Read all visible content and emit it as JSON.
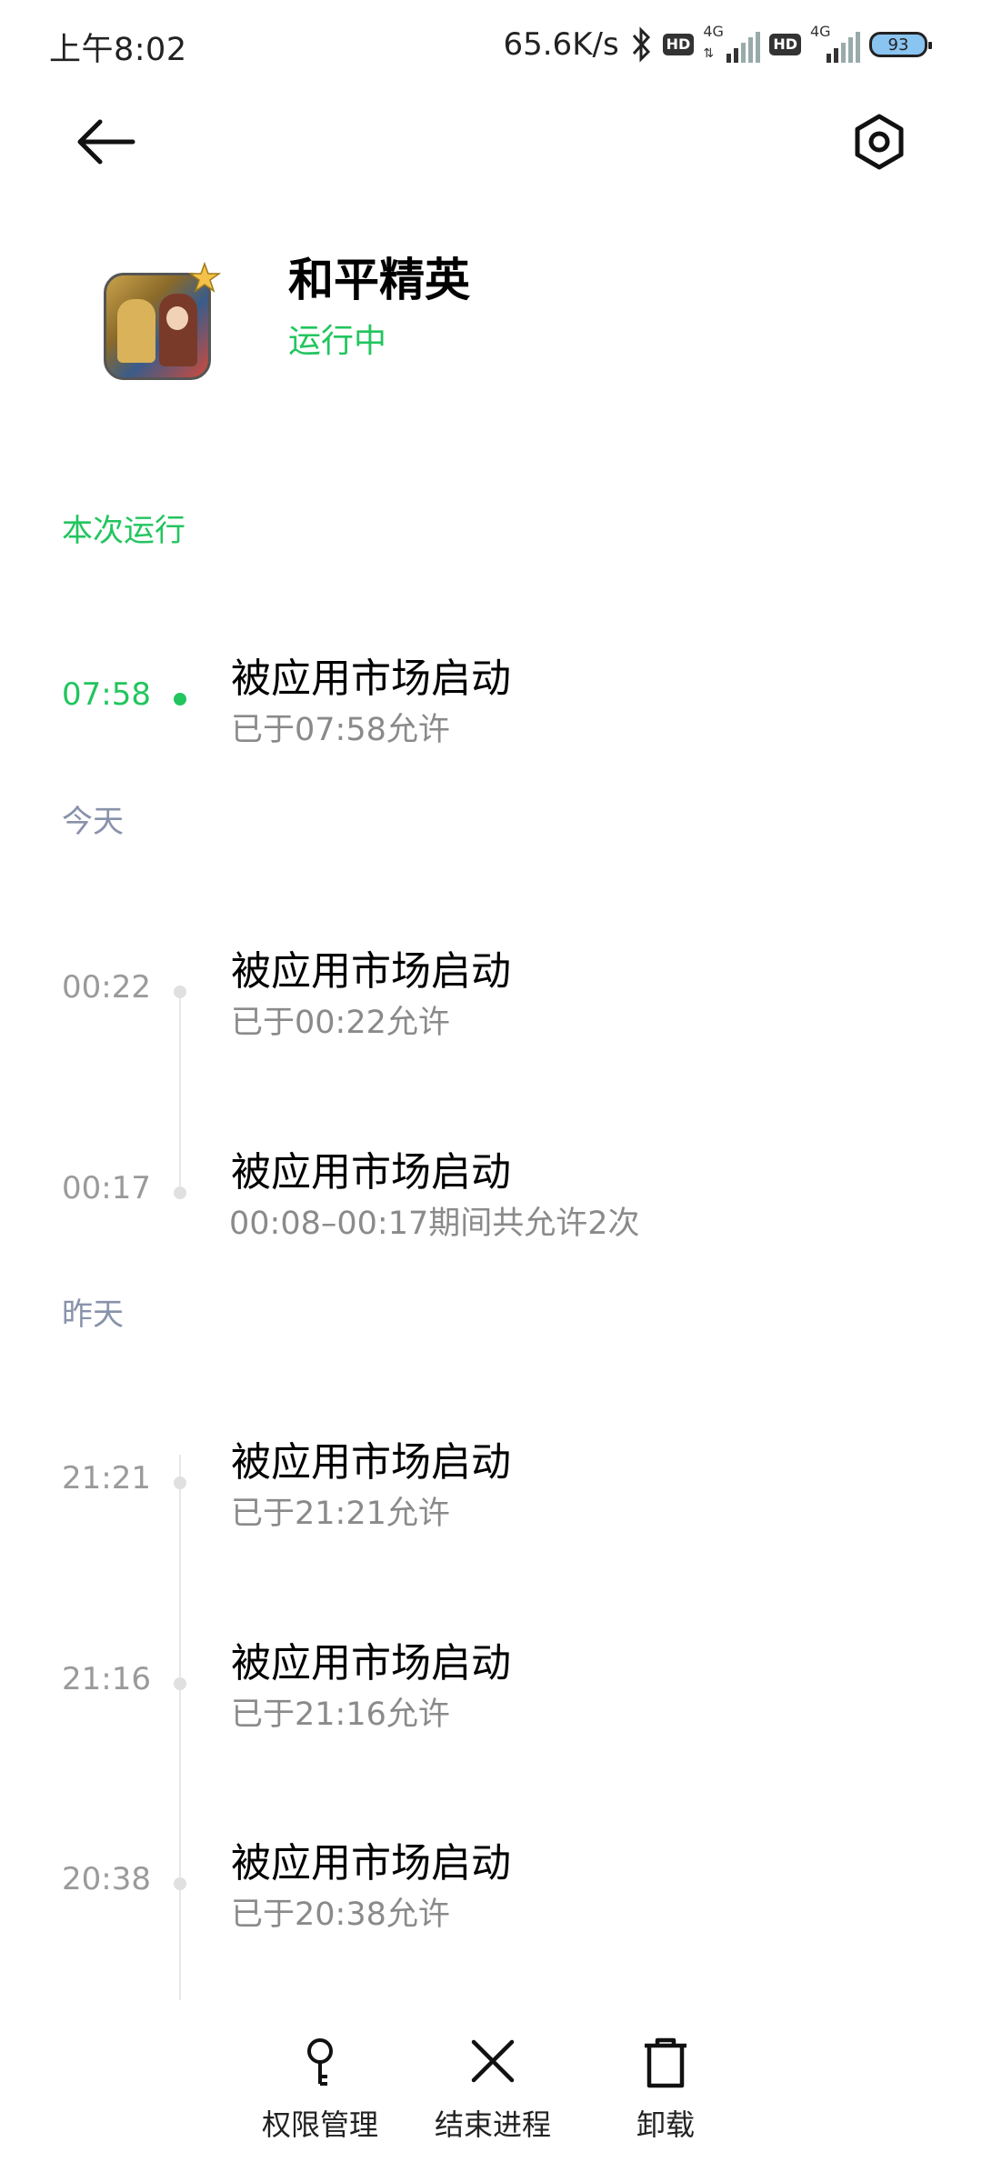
{
  "status_bar": {
    "time": "上午8:02",
    "net_speed": "65.6K/s",
    "hd1": "HD",
    "sig1_label": "4G",
    "hd2": "HD",
    "sig2_label": "4G",
    "battery": "93"
  },
  "header": {
    "back_icon": "back-arrow-icon",
    "settings_icon": "gear-hexagon-icon"
  },
  "app": {
    "name": "和平精英",
    "status": "运行中",
    "status_color": "#22c55e"
  },
  "sections": {
    "current": "本次运行",
    "today": "今天",
    "yesterday": "昨天"
  },
  "entries": [
    {
      "time": "07:58",
      "title": "被应用市场启动",
      "sub": "已于07:58允许"
    },
    {
      "time": "00:22",
      "title": "被应用市场启动",
      "sub": "已于00:22允许"
    },
    {
      "time": "00:17",
      "title": "被应用市场启动",
      "sub": "00:08–00:17期间共允许2次"
    },
    {
      "time": "21:21",
      "title": "被应用市场启动",
      "sub": "已于21:21允许"
    },
    {
      "time": "21:16",
      "title": "被应用市场启动",
      "sub": "已于21:16允许"
    },
    {
      "time": "20:38",
      "title": "被应用市场启动",
      "sub": "已于20:38允许"
    }
  ],
  "bottom_bar": {
    "permissions": "权限管理",
    "end_process": "结束进程",
    "uninstall": "卸载"
  }
}
